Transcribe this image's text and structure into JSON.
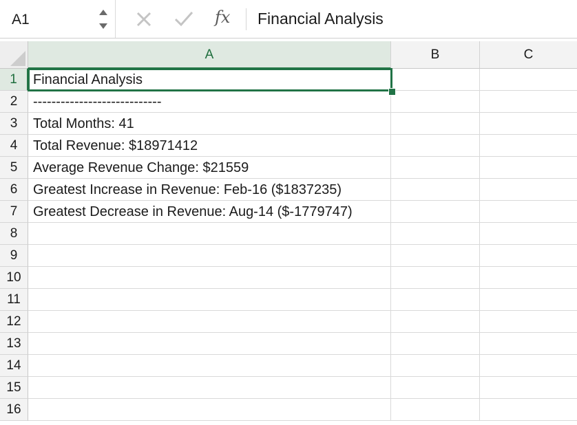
{
  "formula_bar": {
    "name_box": "A1",
    "fx": "fx",
    "value": "Financial Analysis",
    "icons": [
      "stepper-icon",
      "cancel-icon",
      "enter-icon",
      "function-icon"
    ]
  },
  "columns": [
    "A",
    "B",
    "C"
  ],
  "active_cell": "A1",
  "rows": [
    {
      "num": "1",
      "a": "Financial Analysis"
    },
    {
      "num": "2",
      "a": "----------------------------"
    },
    {
      "num": "3",
      "a": "Total Months: 41"
    },
    {
      "num": "4",
      "a": "Total Revenue: $18971412"
    },
    {
      "num": "5",
      "a": "Average Revenue Change: $21559"
    },
    {
      "num": "6",
      "a": "Greatest Increase in Revenue: Feb-16 ($1837235)"
    },
    {
      "num": "7",
      "a": "Greatest Decrease in Revenue: Aug-14 ($-1779747)"
    },
    {
      "num": "8",
      "a": ""
    },
    {
      "num": "9",
      "a": ""
    },
    {
      "num": "10",
      "a": ""
    },
    {
      "num": "11",
      "a": ""
    },
    {
      "num": "12",
      "a": ""
    },
    {
      "num": "13",
      "a": ""
    },
    {
      "num": "14",
      "a": ""
    },
    {
      "num": "15",
      "a": ""
    },
    {
      "num": "16",
      "a": ""
    }
  ],
  "colors": {
    "selection": "#217346",
    "header_bg": "#f3f3f3",
    "selected_header_bg": "#dfe9e1"
  }
}
